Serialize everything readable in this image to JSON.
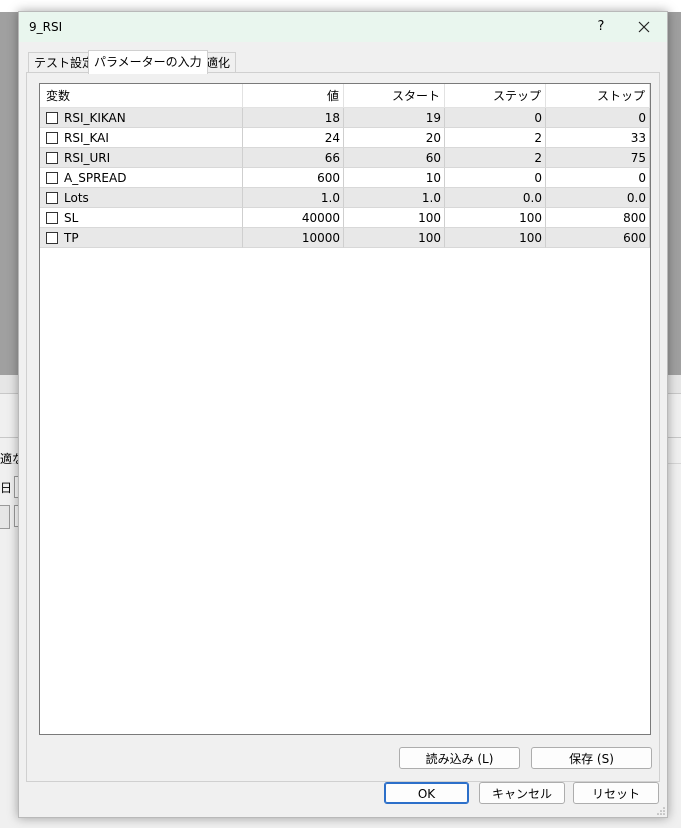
{
  "dialog": {
    "title": "9_RSI",
    "help_label": "?"
  },
  "tabs": [
    {
      "label": "テスト設定"
    },
    {
      "label": "パラメーターの入力"
    },
    {
      "label": "最適化"
    }
  ],
  "grid": {
    "headers": {
      "name": "変数",
      "value": "値",
      "start": "スタート",
      "step": "ステップ",
      "stop": "ストップ"
    },
    "rows": [
      {
        "name": "RSI_KIKAN",
        "value": "18",
        "start": "19",
        "step": "0",
        "stop": "0"
      },
      {
        "name": "RSI_KAI",
        "value": "24",
        "start": "20",
        "step": "2",
        "stop": "33"
      },
      {
        "name": "RSI_URI",
        "value": "66",
        "start": "60",
        "step": "2",
        "stop": "75"
      },
      {
        "name": "A_SPREAD",
        "value": "600",
        "start": "10",
        "step": "0",
        "stop": "0"
      },
      {
        "name": "Lots",
        "value": "1.0",
        "start": "1.0",
        "step": "0.0",
        "stop": "0.0"
      },
      {
        "name": "SL",
        "value": "40000",
        "start": "100",
        "step": "100",
        "stop": "800"
      },
      {
        "name": "TP",
        "value": "10000",
        "start": "100",
        "step": "100",
        "stop": "600"
      }
    ]
  },
  "buttons": {
    "load": "読み込み (L)",
    "save": "保存 (S)",
    "ok": "OK",
    "cancel": "キャンセル",
    "reset": "リセット"
  },
  "background": {
    "fragment_1": "適な",
    "fragment_2": "日"
  }
}
